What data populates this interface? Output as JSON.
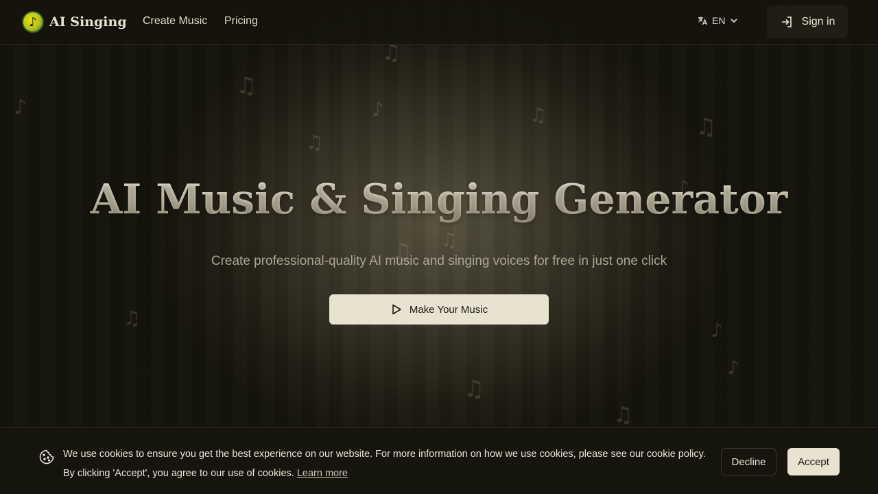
{
  "header": {
    "logo_glyph": "♪",
    "brand": "AI Singing",
    "nav": [
      {
        "label": "Create Music"
      },
      {
        "label": "Pricing"
      }
    ],
    "language": "EN",
    "sign_in": "Sign in"
  },
  "hero": {
    "title": "AI Music & Singing Generator",
    "subtitle": "Create professional-quality AI music and singing voices for free in just one click",
    "cta": "Make Your Music"
  },
  "cookie_banner": {
    "line1": "We use cookies to ensure you get the best experience on our website. For more information on how we use cookies, please see our cookie policy.",
    "line2": "By clicking 'Accept', you agree to our use of cookies.",
    "learn_more": "Learn more",
    "decline": "Decline",
    "accept": "Accept"
  },
  "decor": {
    "note_glyphs": [
      "♫",
      "♪"
    ]
  },
  "colors": {
    "accent": "#e8e2d0",
    "background": "#13120b"
  }
}
